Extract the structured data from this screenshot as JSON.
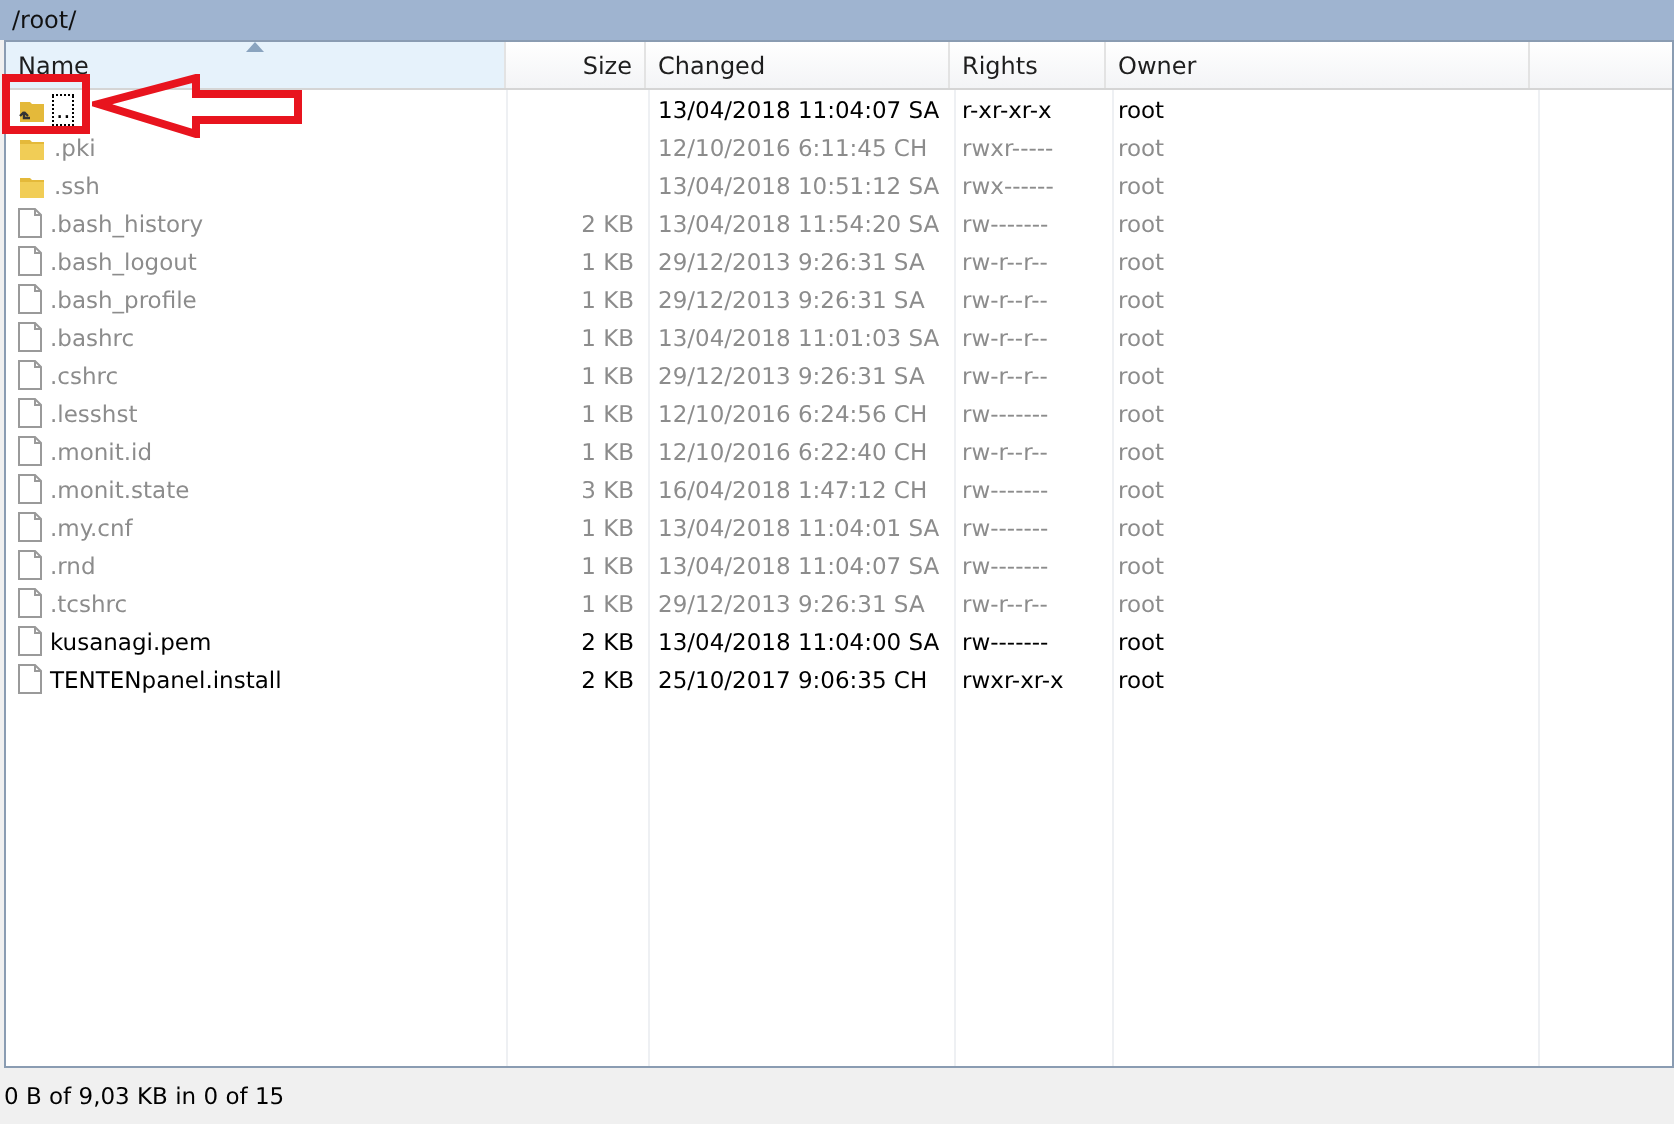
{
  "path": "/root/",
  "columns": [
    {
      "label": "Name",
      "sorted": true
    },
    {
      "label": "Size",
      "sorted": false
    },
    {
      "label": "Changed",
      "sorted": false
    },
    {
      "label": "Rights",
      "sorted": false
    },
    {
      "label": "Owner",
      "sorted": false
    }
  ],
  "rows": [
    {
      "kind": "parent",
      "name": "..",
      "size": "",
      "changed": "13/04/2018 11:04:07 SA",
      "rights": "r-xr-xr-x",
      "owner": "root",
      "hidden": false,
      "focused": true
    },
    {
      "kind": "folder",
      "name": ".pki",
      "size": "",
      "changed": "12/10/2016 6:11:45 CH",
      "rights": "rwxr-----",
      "owner": "root",
      "hidden": true,
      "focused": false
    },
    {
      "kind": "folder",
      "name": ".ssh",
      "size": "",
      "changed": "13/04/2018 10:51:12 SA",
      "rights": "rwx------",
      "owner": "root",
      "hidden": true,
      "focused": false
    },
    {
      "kind": "file",
      "name": ".bash_history",
      "size": "2 KB",
      "changed": "13/04/2018 11:54:20 SA",
      "rights": "rw-------",
      "owner": "root",
      "hidden": true,
      "focused": false
    },
    {
      "kind": "file",
      "name": ".bash_logout",
      "size": "1 KB",
      "changed": "29/12/2013 9:26:31 SA",
      "rights": "rw-r--r--",
      "owner": "root",
      "hidden": true,
      "focused": false
    },
    {
      "kind": "file",
      "name": ".bash_profile",
      "size": "1 KB",
      "changed": "29/12/2013 9:26:31 SA",
      "rights": "rw-r--r--",
      "owner": "root",
      "hidden": true,
      "focused": false
    },
    {
      "kind": "file",
      "name": ".bashrc",
      "size": "1 KB",
      "changed": "13/04/2018 11:01:03 SA",
      "rights": "rw-r--r--",
      "owner": "root",
      "hidden": true,
      "focused": false
    },
    {
      "kind": "file",
      "name": ".cshrc",
      "size": "1 KB",
      "changed": "29/12/2013 9:26:31 SA",
      "rights": "rw-r--r--",
      "owner": "root",
      "hidden": true,
      "focused": false
    },
    {
      "kind": "file",
      "name": ".lesshst",
      "size": "1 KB",
      "changed": "12/10/2016 6:24:56 CH",
      "rights": "rw-------",
      "owner": "root",
      "hidden": true,
      "focused": false
    },
    {
      "kind": "file",
      "name": ".monit.id",
      "size": "1 KB",
      "changed": "12/10/2016 6:22:40 CH",
      "rights": "rw-r--r--",
      "owner": "root",
      "hidden": true,
      "focused": false
    },
    {
      "kind": "file",
      "name": ".monit.state",
      "size": "3 KB",
      "changed": "16/04/2018 1:47:12 CH",
      "rights": "rw-------",
      "owner": "root",
      "hidden": true,
      "focused": false
    },
    {
      "kind": "file",
      "name": ".my.cnf",
      "size": "1 KB",
      "changed": "13/04/2018 11:04:01 SA",
      "rights": "rw-------",
      "owner": "root",
      "hidden": true,
      "focused": false
    },
    {
      "kind": "file",
      "name": ".rnd",
      "size": "1 KB",
      "changed": "13/04/2018 11:04:07 SA",
      "rights": "rw-------",
      "owner": "root",
      "hidden": true,
      "focused": false
    },
    {
      "kind": "file",
      "name": ".tcshrc",
      "size": "1 KB",
      "changed": "29/12/2013 9:26:31 SA",
      "rights": "rw-r--r--",
      "owner": "root",
      "hidden": true,
      "focused": false
    },
    {
      "kind": "file",
      "name": "kusanagi.pem",
      "size": "2 KB",
      "changed": "13/04/2018 11:04:00 SA",
      "rights": "rw-------",
      "owner": "root",
      "hidden": false,
      "focused": false
    },
    {
      "kind": "file",
      "name": "TENTENpanel.install",
      "size": "2 KB",
      "changed": "25/10/2017 9:06:35 CH",
      "rights": "rwxr-xr-x",
      "owner": "root",
      "hidden": false,
      "focused": false
    }
  ],
  "status_bar": "0 B of 9,03 KB in 0 of 15"
}
